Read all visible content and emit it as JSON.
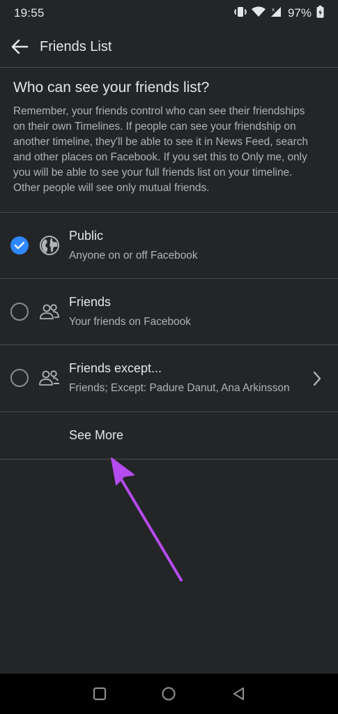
{
  "status_bar": {
    "time": "19:55",
    "battery_percent": "97%",
    "icons": [
      "vibrate-icon",
      "wifi-icon",
      "signal-icon",
      "battery-icon"
    ]
  },
  "app_bar": {
    "title": "Friends List",
    "back_icon": "arrow-left-icon"
  },
  "intro": {
    "heading": "Who can see your friends list?",
    "body_lines": [
      "Remember, your friends control who can see their friendships",
      "on their own Timelines. If people can see your friendship on",
      "another timeline, they'll be able to see it in News Feed, search",
      "and other places on Facebook. If you set this to Only me, only",
      "you will be able to see your full friends list on your timeline.",
      "Other people will see only mutual friends."
    ]
  },
  "options": [
    {
      "title": "Public",
      "subtitle": "Anyone on or off Facebook",
      "selected": true,
      "icon": "globe-icon"
    },
    {
      "title": "Friends",
      "subtitle": "Your friends on Facebook",
      "selected": false,
      "icon": "friends-icon"
    },
    {
      "title": "Friends except...",
      "subtitle": "Friends; Except: Padure Danut, Ana Arkinsson",
      "selected": false,
      "icon": "friends-except-icon",
      "has_chevron": true
    }
  ],
  "see_more": "See More",
  "colors": {
    "background": "#242526",
    "accent": "#2d88ff",
    "annotation_arrow": "#b44cf0",
    "divider": "#4a4b4d"
  }
}
